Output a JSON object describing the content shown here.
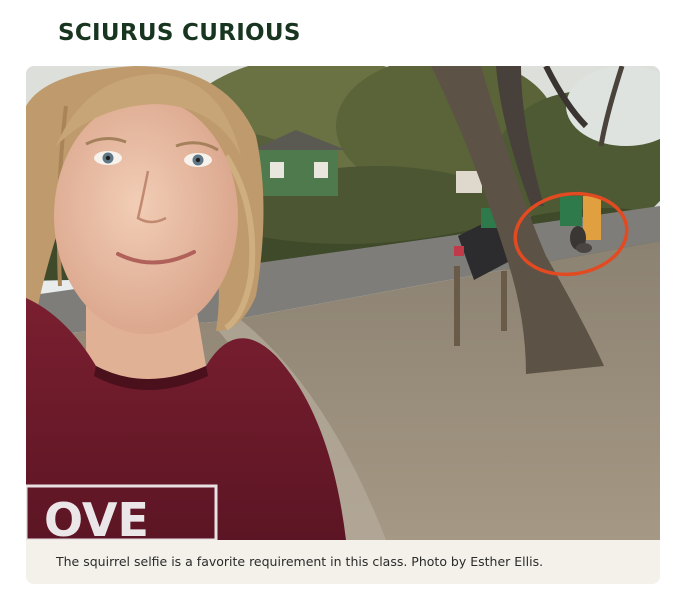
{
  "article": {
    "heading": "SCIURUS CURIOUS",
    "caption": "The squirrel selfie is a favorite requirement in this class. Photo by Esther Ellis."
  },
  "photo": {
    "subject": "selfie of a smiling woman in a maroon t-shirt on a gravel roadside, with a tree and mailboxes behind her; a squirrel on the tree is circled in red",
    "shirt_text": "OVE",
    "colors": {
      "shirt": "#6e1a2a",
      "highlight_circle": "#e24a22",
      "sky": "#e9ecef",
      "foliage": "#5f6b3f",
      "road": "#7e7c78",
      "ground": "#9b8e7c"
    }
  }
}
